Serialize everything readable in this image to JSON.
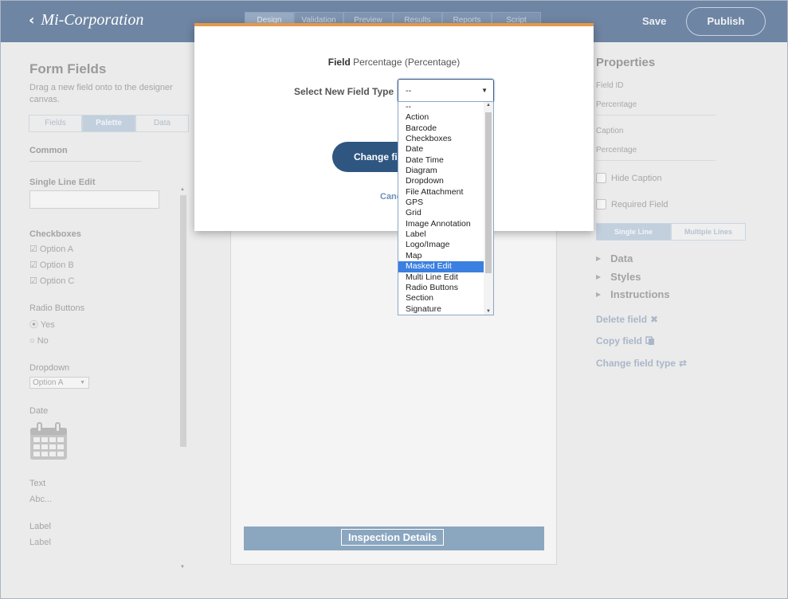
{
  "header": {
    "brand": "Mi-Corporation",
    "tabs": [
      "Design",
      "Validation",
      "Preview",
      "Results",
      "Reports",
      "Script"
    ],
    "save_label": "Save",
    "publish_label": "Publish"
  },
  "left_panel": {
    "title": "Form Fields",
    "subtitle": "Drag a new field onto to the designer canvas.",
    "tabs": [
      "Fields",
      "Palette",
      "Data"
    ],
    "common_label": "Common",
    "single_line_label": "Single Line Edit",
    "checkboxes_label": "Checkboxes",
    "checkbox_options": [
      "Option A",
      "Option B",
      "Option C"
    ],
    "radio_label": "Radio Buttons",
    "radio_options": [
      "Yes",
      "No"
    ],
    "dropdown_label": "Dropdown",
    "dropdown_value": "Option A",
    "date_label": "Date",
    "text_label": "Text",
    "text_sample": "Abc...",
    "label_label": "Label",
    "label_sample": "Label"
  },
  "canvas": {
    "section_title": "Inspection Details"
  },
  "right_panel": {
    "title": "Properties",
    "field_id_label": "Field ID",
    "field_id_value": "Percentage",
    "caption_label": "Caption",
    "caption_value": "Percentage",
    "hide_caption_label": "Hide Caption",
    "required_field_label": "Required Field",
    "toggle": [
      "Single Line",
      "Multiple Lines"
    ],
    "sections": [
      "Data",
      "Styles",
      "Instructions"
    ],
    "delete_label": "Delete field",
    "copy_label": "Copy field",
    "change_type_label": "Change field type"
  },
  "modal": {
    "field_prefix": "Field",
    "field_value": "Percentage (Percentage)",
    "select_label": "Select New Field Type",
    "select_value": "--",
    "change_button": "Change fi",
    "cancel": "Canc"
  },
  "dropdown": {
    "options": [
      "--",
      "Action",
      "Barcode",
      "Checkboxes",
      "Date",
      "Date Time",
      "Diagram",
      "Dropdown",
      "File Attachment",
      "GPS",
      "Grid",
      "Image Annotation",
      "Label",
      "Logo/Image",
      "Map",
      "Masked Edit",
      "Multi Line Edit",
      "Radio Buttons",
      "Section",
      "Signature"
    ],
    "highlighted": "Masked Edit"
  }
}
